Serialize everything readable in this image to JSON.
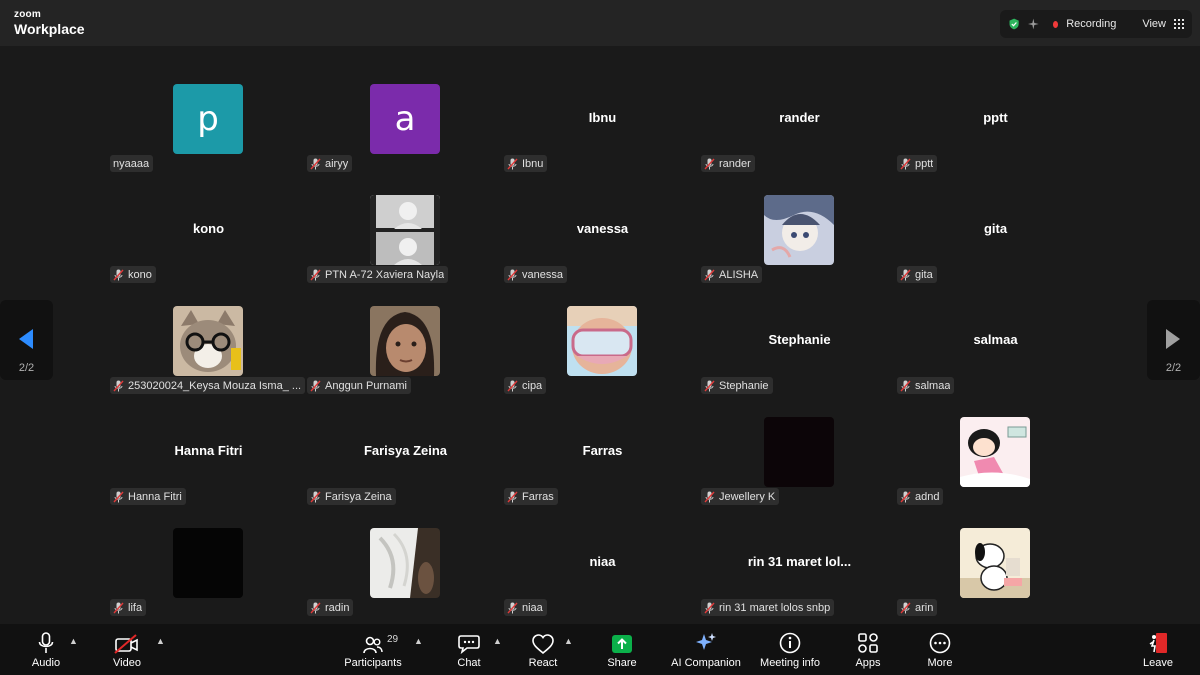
{
  "app": {
    "logo_small": "zoom",
    "logo_big": "Workplace"
  },
  "topbar": {
    "recording_label": "Recording",
    "view_label": "View",
    "recording_color": "#ef3a3a",
    "shield_color": "#2db55d"
  },
  "pager": {
    "left_label": "2/2",
    "right_label": "2/2",
    "accent": "#2d8cff"
  },
  "participants": [
    {
      "name": "nyaaaa",
      "avatar": "p",
      "avatar_color": "#1c9aa8"
    },
    {
      "name": "airyy",
      "avatar": "a",
      "avatar_color": "#7b2bab"
    },
    {
      "name": "Ibnu",
      "display": "Ibnu"
    },
    {
      "name": "rander",
      "display": "rander"
    },
    {
      "name": "pptt",
      "display": "pptt"
    },
    {
      "name": "kono",
      "display": "kono"
    },
    {
      "name": "PTN A-72 Xaviera Nayla",
      "photo": "bw-photo"
    },
    {
      "name": "vanessa",
      "display": "vanessa"
    },
    {
      "name": "ALISHA",
      "photo": "anime-photo"
    },
    {
      "name": "gita",
      "display": "gita"
    },
    {
      "name": "253020024_Keysa Mouza Isma_ ...",
      "photo": "cat-photo"
    },
    {
      "name": "Anggun Purnami",
      "photo": "selfie-photo"
    },
    {
      "name": "cipa",
      "photo": "goggles-photo"
    },
    {
      "name": "Stephanie",
      "display": "Stephanie"
    },
    {
      "name": "salmaa",
      "display": "salmaa"
    },
    {
      "name": "Hanna Fitri",
      "display": "Hanna Fitri"
    },
    {
      "name": "Farisya Zeina",
      "display": "Farisya Zeina"
    },
    {
      "name": "Farras",
      "display": "Farras"
    },
    {
      "name": "Jewellery K",
      "photo": "dark-photo"
    },
    {
      "name": "adnd",
      "photo": "cartoon-photo"
    },
    {
      "name": "lifa",
      "photo": "black-photo"
    },
    {
      "name": "radin",
      "photo": "cloth-photo"
    },
    {
      "name": "niaa",
      "display": "niaa"
    },
    {
      "name": "rin 31 maret lolos snbp",
      "display": "rin 31 maret lol..."
    },
    {
      "name": "arin",
      "photo": "snoopy-photo"
    }
  ],
  "toolbar": {
    "audio": "Audio",
    "video": "Video",
    "participants": "Participants",
    "participants_count": "29",
    "chat": "Chat",
    "react": "React",
    "share": "Share",
    "ai_companion": "AI Companion",
    "meeting_info": "Meeting info",
    "apps": "Apps",
    "more": "More",
    "leave": "Leave",
    "share_color": "#0bb04a",
    "leave_color": "#e02828"
  }
}
